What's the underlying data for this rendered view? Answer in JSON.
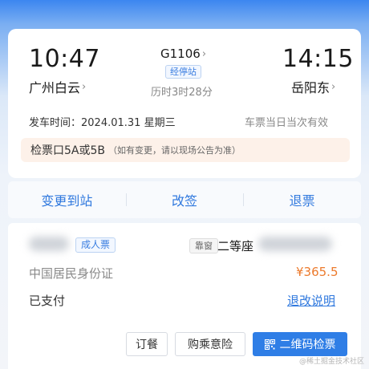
{
  "journey": {
    "depart_time": "10:47",
    "depart_station": "广州白云",
    "arrive_time": "14:15",
    "arrive_station": "岳阳东",
    "train_no": "G1106",
    "stops_label": "经停站",
    "duration": "历时3时28分"
  },
  "departure_info": {
    "label_date": "发车时间：2024.01.31 星期三",
    "validity": "车票当日当次有效"
  },
  "gate": {
    "main": "检票口5A或5B",
    "note": "（如有变更，请以现场公告为准）"
  },
  "actions": [
    {
      "label": "变更到站"
    },
    {
      "label": "改签"
    },
    {
      "label": "退票"
    }
  ],
  "passenger": {
    "ticket_type": "成人票",
    "seat_tag": "靠窗",
    "seat_class": "二等座",
    "id_type": "中国居民身份证",
    "price": "¥365.5",
    "pay_status": "已支付",
    "refund_link": "退改说明"
  },
  "buttons": {
    "meal": "订餐",
    "insurance": "购乘意险",
    "qr_check": "二维码检票"
  },
  "watermark": "@稀土掘金技术社区",
  "colors": {
    "accent": "#2f78de",
    "price": "#ec7a2c",
    "primary_button": "#2f7ee6"
  }
}
